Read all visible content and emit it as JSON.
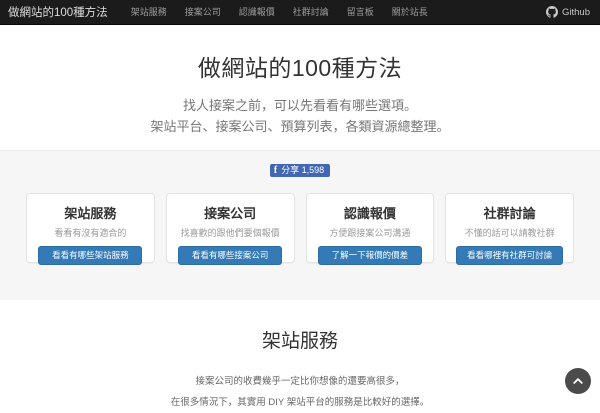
{
  "navbar": {
    "brand": "做網站的100種方法",
    "items": [
      "架站服務",
      "接案公司",
      "認識報價",
      "社群討論",
      "留言板",
      "關於站長"
    ],
    "github_label": "Github"
  },
  "hero": {
    "title": "做網站的100種方法",
    "subtitle_line1": "找人接案之前，可以先看看有哪些選項。",
    "subtitle_line2": "架站平台、接案公司、預算列表，各類資源總整理。"
  },
  "share": {
    "label": "分享 1,598",
    "icon": "facebook-f"
  },
  "cards": [
    {
      "title": "架站服務",
      "desc": "看看有沒有適合的",
      "button": "看看有哪些架站服務"
    },
    {
      "title": "接案公司",
      "desc": "找喜歡的跟他們要個報價",
      "button": "看看有哪些接案公司"
    },
    {
      "title": "認識報價",
      "desc": "方便跟接案公司溝通",
      "button": "了解一下報價的價差"
    },
    {
      "title": "社群討論",
      "desc": "不懂的話可以請教社群",
      "button": "看看哪裡有社群可討論"
    }
  ],
  "section": {
    "heading": "架站服務",
    "line1": "接案公司的收費幾乎一定比你想像的還要高很多，",
    "line2": "在很多情況下，其實用 DIY 架站平台的服務是比較好的選擇。"
  },
  "colors": {
    "navbar_bg": "#1b1b1b",
    "band_bg": "#f6f6f6",
    "primary_button": "#337ab7",
    "facebook_blue": "#4267b2",
    "scroll_top_bg": "#4b4b4b"
  }
}
